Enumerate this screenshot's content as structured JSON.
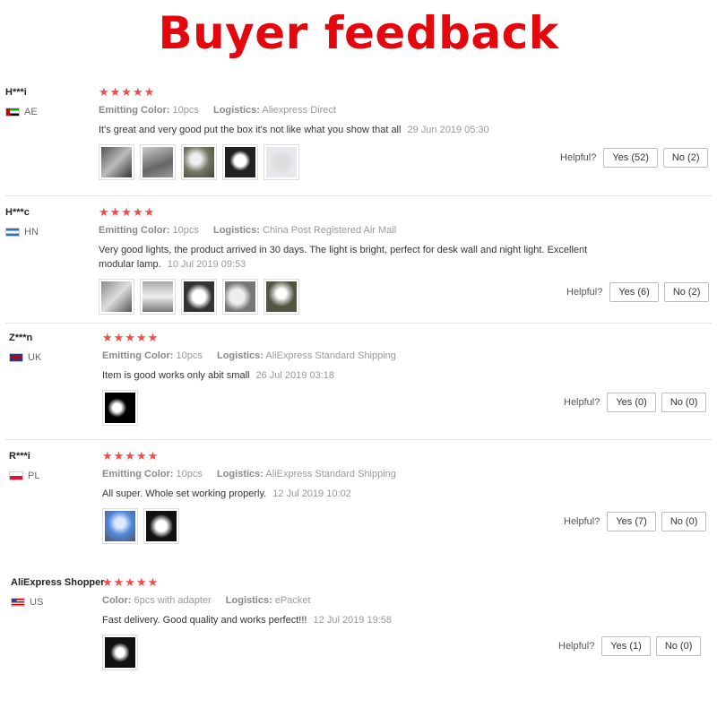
{
  "page": {
    "title": "Buyer feedback"
  },
  "labels": {
    "logistics": "Logistics:",
    "helpful": "Helpful?"
  },
  "colors": {
    "title": "#e3080e",
    "stars": "#f54a4a"
  },
  "reviews": [
    {
      "user": "H***i",
      "country": "AE",
      "stars": "★★★★★",
      "attr_label": "Emitting Color:",
      "attr_value": "10pcs",
      "logistics": "Aliexpress Direct",
      "text": "It's great and very good put the box it's not like what you show that all",
      "date": "29 Jun 2019 05:30",
      "yes": "Yes (52)",
      "no": "No (2)"
    },
    {
      "user": "H***c",
      "country": "HN",
      "stars": "★★★★★",
      "attr_label": "Emitting Color:",
      "attr_value": "10pcs",
      "logistics": "China Post Registered Air Mail",
      "text": "Very good lights, the product arrived in 30 days. The light is bright, perfect for desk wall and night light. Excellent modular lamp.",
      "date": "10 Jul 2019 09:53",
      "yes": "Yes (6)",
      "no": "No (2)"
    },
    {
      "user": "Z***n",
      "country": "UK",
      "stars": "★★★★★",
      "attr_label": "Emitting Color:",
      "attr_value": "10pcs",
      "logistics": "AliExpress Standard Shipping",
      "text": "Item is good works only abit small",
      "date": "26 Jul 2019 03:18",
      "yes": "Yes (0)",
      "no": "No (0)"
    },
    {
      "user": "R***i",
      "country": "PL",
      "stars": "★★★★★",
      "attr_label": "Emitting Color:",
      "attr_value": "10pcs",
      "logistics": "AliExpress Standard Shipping",
      "text": "All super. Whole set working properly.",
      "date": "12 Jul 2019 10:02",
      "yes": "Yes (7)",
      "no": "No (0)"
    },
    {
      "user": "AliExpress Shopper",
      "country": "US",
      "stars": "★★★★★",
      "attr_label": "Color:",
      "attr_value": "6pcs with adapter",
      "logistics": "ePacket",
      "text": "Fast delivery. Good quality and works perfect!!!",
      "date": "12 Jul 2019 19:58",
      "yes": "Yes (1)",
      "no": "No (0)"
    }
  ]
}
